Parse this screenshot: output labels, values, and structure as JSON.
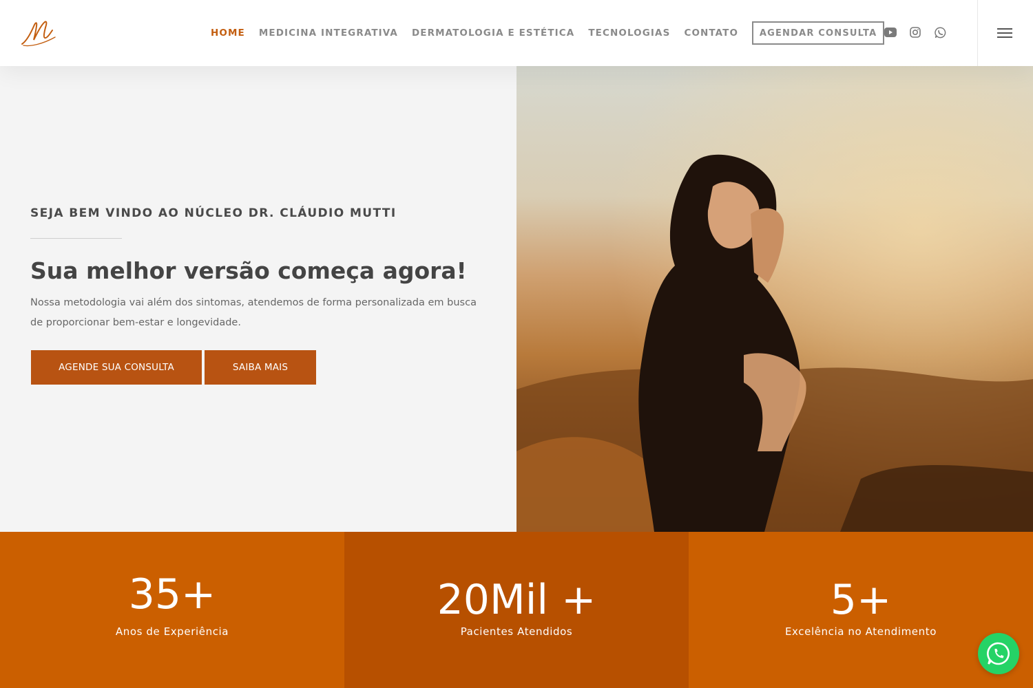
{
  "header": {
    "logo_icon": "mutti-monogram-logo",
    "nav": [
      {
        "label": "HOME",
        "active": true
      },
      {
        "label": "MEDICINA INTEGRATIVA",
        "active": false
      },
      {
        "label": "DERMATOLOGIA E ESTÉTICA",
        "active": false
      },
      {
        "label": "TECNOLOGIAS",
        "active": false
      },
      {
        "label": "CONTATO",
        "active": false
      }
    ],
    "cta_label": "AGENDAR CONSULTA",
    "socials": [
      "youtube-icon",
      "instagram-icon",
      "whatsapp-icon"
    ],
    "menu_icon": "hamburger-menu-icon"
  },
  "hero": {
    "eyebrow": "SEJA BEM VINDO AO NÚCLEO DR. CLÁUDIO MUTTI",
    "title": "Sua melhor versão começa agora!",
    "text": "Nossa metodologia vai além dos sintomas, atendemos de forma personalizada em busca de proporcionar bem-estar e longevidade.",
    "primary_button": "AGENDE SUA CONSULTA",
    "secondary_button": "SAIBA MAIS",
    "image": "woman-in-hoodie-resting-at-sunset-photo"
  },
  "stats": [
    {
      "value": "35+",
      "label": "Anos de Experiência"
    },
    {
      "value": "20Mil +",
      "label": "Pacientes Atendidos"
    },
    {
      "value": "5+",
      "label": "Excelência no Atendimento"
    }
  ],
  "floating_button": "whatsapp-chat-icon",
  "colors": {
    "accent": "#c35e10",
    "button": "#b85312",
    "stat_light": "#cb5f00",
    "stat_dark": "#b75000",
    "whatsapp": "#25d366"
  }
}
